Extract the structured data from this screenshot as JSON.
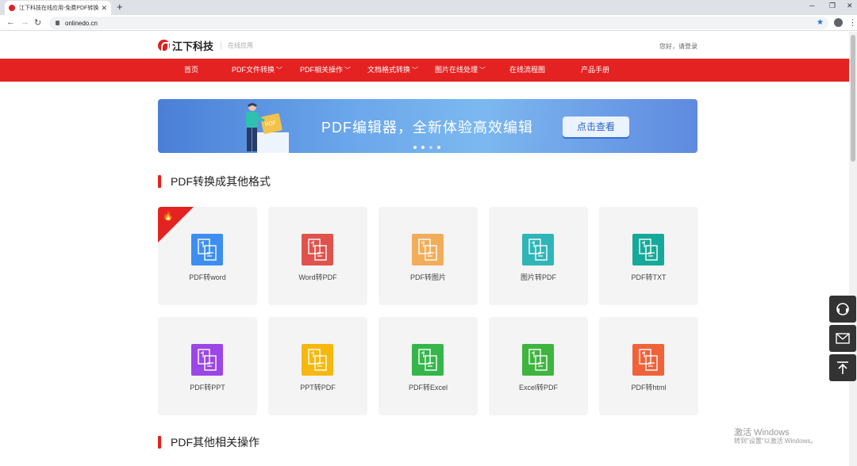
{
  "browser": {
    "tab_title": "江下科技在线应用-免费PDF转换",
    "tab_close": "✕",
    "new_tab": "+",
    "url": "onlinedo.cn"
  },
  "header": {
    "logo_text": "江下科技",
    "logo_sub": "在线应用",
    "login": "您好，请登录"
  },
  "nav": {
    "items": [
      {
        "label": "首页",
        "dropdown": false
      },
      {
        "label": "PDF文件转换",
        "dropdown": true
      },
      {
        "label": "PDF相关操作",
        "dropdown": true
      },
      {
        "label": "文档格式转换",
        "dropdown": true
      },
      {
        "label": "图片在线处理",
        "dropdown": true
      },
      {
        "label": "在线流程图",
        "dropdown": false
      },
      {
        "label": "产品手册",
        "dropdown": false
      }
    ]
  },
  "banner": {
    "text": "PDF编辑器，全新体验高效编辑",
    "button": "点击查看",
    "figure_badge": "PDF"
  },
  "section1": {
    "title": "PDF转换成其他格式"
  },
  "section2": {
    "title": "PDF其他相关操作"
  },
  "tools": [
    {
      "label": "PDF转word",
      "color": "#3d8ef0",
      "icon": "pdf-to-word-icon",
      "hot": true
    },
    {
      "label": "Word转PDF",
      "color": "#e0524c",
      "icon": "word-to-pdf-icon",
      "hot": false
    },
    {
      "label": "PDF转图片",
      "color": "#f2ad5a",
      "icon": "pdf-to-image-icon",
      "hot": false
    },
    {
      "label": "图片转PDF",
      "color": "#2fb5b8",
      "icon": "image-to-pdf-icon",
      "hot": false
    },
    {
      "label": "PDF转TXT",
      "color": "#16a99a",
      "icon": "pdf-to-txt-icon",
      "hot": false
    },
    {
      "label": "PDF转PPT",
      "color": "#9b46e6",
      "icon": "pdf-to-ppt-icon",
      "hot": false
    },
    {
      "label": "PPT转PDF",
      "color": "#f7b80e",
      "icon": "ppt-to-pdf-icon",
      "hot": false
    },
    {
      "label": "PDF转Excel",
      "color": "#35b64a",
      "icon": "pdf-to-excel-icon",
      "hot": false
    },
    {
      "label": "Excel转PDF",
      "color": "#3fb43f",
      "icon": "excel-to-pdf-icon",
      "hot": false
    },
    {
      "label": "PDF转html",
      "color": "#f0623a",
      "icon": "pdf-to-html-icon",
      "hot": false
    }
  ],
  "watermark": {
    "line1": "激活 Windows",
    "line2": "转到\"设置\"以激活 Windows。"
  }
}
